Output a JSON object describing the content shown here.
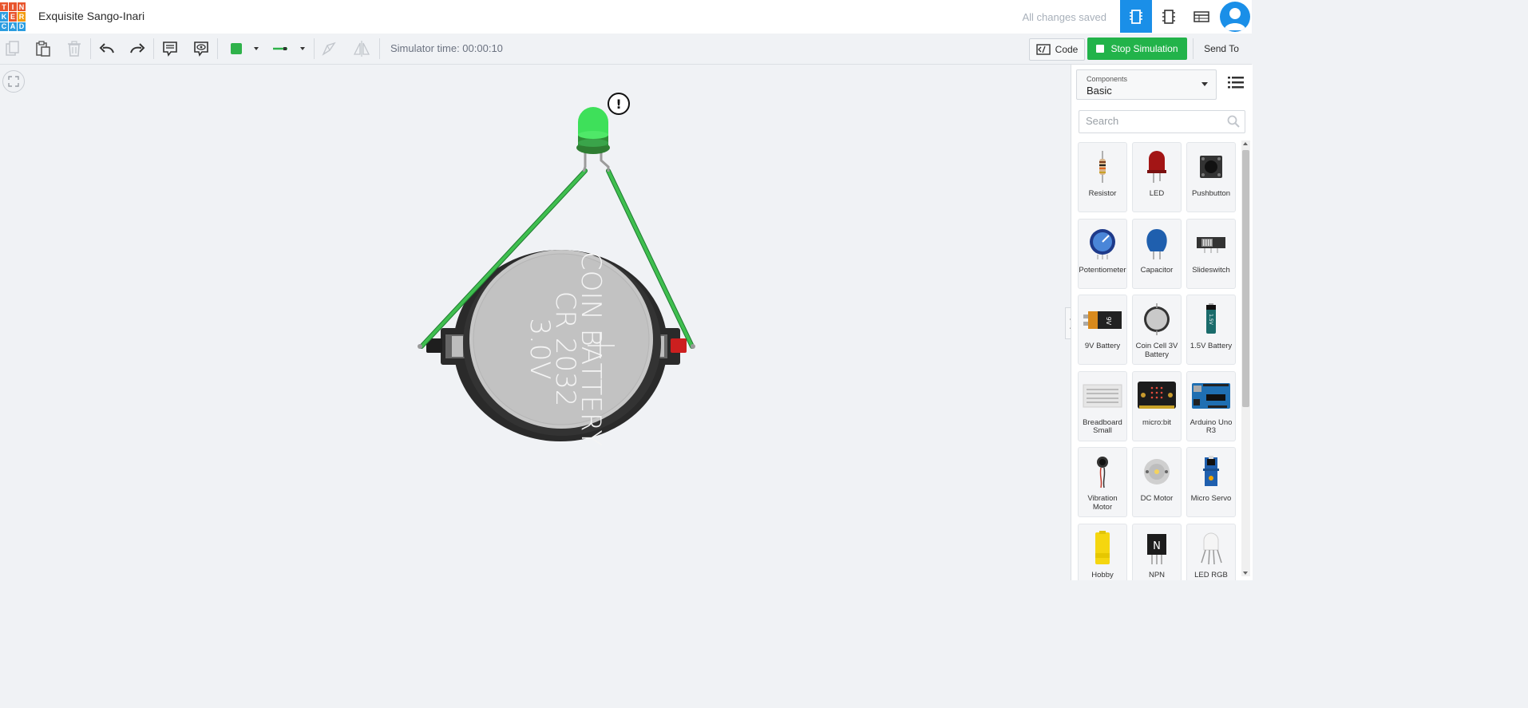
{
  "app": {
    "logo_letters": [
      "T",
      "I",
      "N",
      "K",
      "E",
      "R",
      "C",
      "A",
      "D"
    ],
    "logo_colors": [
      "#e8552d",
      "#e8552d",
      "#e8552d",
      "#2b9de0",
      "#e8552d",
      "#f39c12",
      "#2b9de0",
      "#2b9de0",
      "#2b9de0"
    ],
    "design_title": "Exquisite Sango-Inari",
    "save_status": "All changes saved",
    "view_buttons": [
      "circuit-view-icon",
      "schematic-view-icon",
      "component-list-icon"
    ],
    "accent": "#1a8fe8"
  },
  "toolbar": {
    "simulator_time_label": "Simulator time: 00:00:10",
    "code_label": "Code",
    "stop_label": "Stop Simulation",
    "send_label": "Send To",
    "wire_color": "#2fb24a"
  },
  "canvas": {
    "battery_line1": "COIN BATTERY",
    "battery_line2": "CR 2032",
    "battery_line3": "3.0V",
    "led_color": "#3ee05a",
    "wire_color": "#36b34a",
    "warning_glyph": "!"
  },
  "panel": {
    "components_label": "Components",
    "components_value": "Basic",
    "search_placeholder": "Search",
    "items": [
      {
        "label": "Resistor",
        "icon": "resistor-icon"
      },
      {
        "label": "LED",
        "icon": "led-icon"
      },
      {
        "label": "Pushbutton",
        "icon": "pushbutton-icon"
      },
      {
        "label": "Potentiometer",
        "icon": "potentiometer-icon"
      },
      {
        "label": "Capacitor",
        "icon": "capacitor-icon"
      },
      {
        "label": "Slideswitch",
        "icon": "slideswitch-icon"
      },
      {
        "label": "9V Battery",
        "icon": "9v-battery-icon"
      },
      {
        "label": "Coin Cell 3V Battery",
        "icon": "coin-cell-icon"
      },
      {
        "label": "1.5V Battery",
        "icon": "aa-battery-icon"
      },
      {
        "label": "Breadboard Small",
        "icon": "breadboard-icon"
      },
      {
        "label": "micro:bit",
        "icon": "microbit-icon"
      },
      {
        "label": "Arduino Uno R3",
        "icon": "arduino-icon"
      },
      {
        "label": "Vibration Motor",
        "icon": "vibration-motor-icon"
      },
      {
        "label": "DC Motor",
        "icon": "dc-motor-icon"
      },
      {
        "label": "Micro Servo",
        "icon": "micro-servo-icon"
      },
      {
        "label": "Hobby",
        "icon": "hobby-gearmotor-icon"
      },
      {
        "label": "NPN",
        "icon": "npn-transistor-icon"
      },
      {
        "label": "LED RGB",
        "icon": "rgb-led-icon"
      }
    ]
  }
}
